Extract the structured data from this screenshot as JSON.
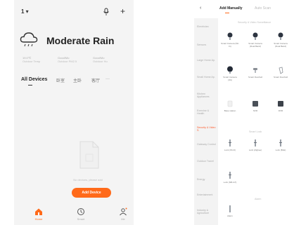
{
  "left": {
    "home_switcher": "1 ▾",
    "add_icon": "+",
    "weather": {
      "title": "Moderate Rain",
      "stats": [
        {
          "value": "19.0℃",
          "label": "Outdoor Temp"
        },
        {
          "value": "Good/Mo",
          "label": "Outdoor PM2.5"
        },
        {
          "value": "Good/Mo",
          "label": "Outdoor Hu"
        }
      ]
    },
    "tabs": [
      "All Devices",
      "卧室",
      "主卧",
      "客厅",
      "···"
    ],
    "empty_text": "No devices, please add",
    "add_device_label": "Add Device",
    "bottom_nav": [
      {
        "label": "Home",
        "icon": "home-icon"
      },
      {
        "label": "Smart",
        "icon": "smart-icon"
      },
      {
        "label": "Me",
        "icon": "me-icon"
      }
    ],
    "accent": "#ff6a1a"
  },
  "right": {
    "back_icon": "‹",
    "tabs": {
      "active": "Add Manually",
      "inactive": "Auto Scan"
    },
    "categories": [
      "Electrician",
      "Sensors",
      "Large Home Ap.",
      "Small Home Ap.",
      "Kitchen Appliances",
      "Exercise & Health",
      "Security & Video S.",
      "Gateway Control",
      "Outdoor Travel",
      "Energy",
      "Entertainment",
      "Industry & Agriculture"
    ],
    "active_category_index": 6,
    "section1_title": "Security & Video Surveillance",
    "section1_devices": [
      "Smart Camera (Wi-Fi)",
      "Smart Camera (Dual Band)",
      "Smart Camera (Dual Band)",
      "Smart Camera (4G)",
      "Smart Doorbell",
      "Smart Doorbell",
      "Base station",
      "NVR",
      "DVR"
    ],
    "section2_title": "Smart Lock",
    "section2_devices": [
      "Lock (Wi-Fi)",
      "Lock (Zigbee)",
      "Lock (BLE)",
      "Lock (NB-IoT)"
    ],
    "section3_title": "Alarm",
    "section3_devices": [
      "Alarm"
    ]
  }
}
